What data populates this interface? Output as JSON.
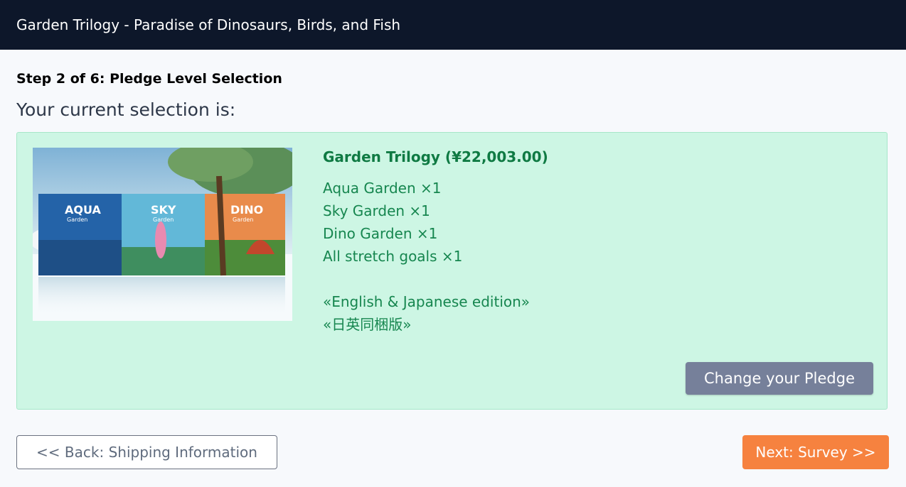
{
  "header": {
    "title": "Garden Trilogy - Paradise of Dinosaurs, Birds, and Fish"
  },
  "main": {
    "step_label": "Step 2 of 6: Pledge Level Selection",
    "current_label": "Your current selection is:"
  },
  "pledge": {
    "title": "Garden Trilogy (¥22,003.00)",
    "items": [
      "Aqua Garden ×1",
      "Sky Garden ×1",
      "Dino Garden ×1",
      "All stretch goals ×1"
    ],
    "edition_en": "«English & Japanese edition»",
    "edition_jp": "«日英同梱版»",
    "box_labels": [
      "AQUA",
      "SKY",
      "DINO"
    ],
    "box_sublabel": "Garden"
  },
  "buttons": {
    "change": "Change your Pledge",
    "back": "<< Back: Shipping Information",
    "next": "Next: Survey >>"
  },
  "colors": {
    "header_bg": "#0d172a",
    "card_bg": "#cdf6e4",
    "pledge_text": "#16864f",
    "change_bg": "#76809a",
    "next_bg": "#f6823f"
  }
}
